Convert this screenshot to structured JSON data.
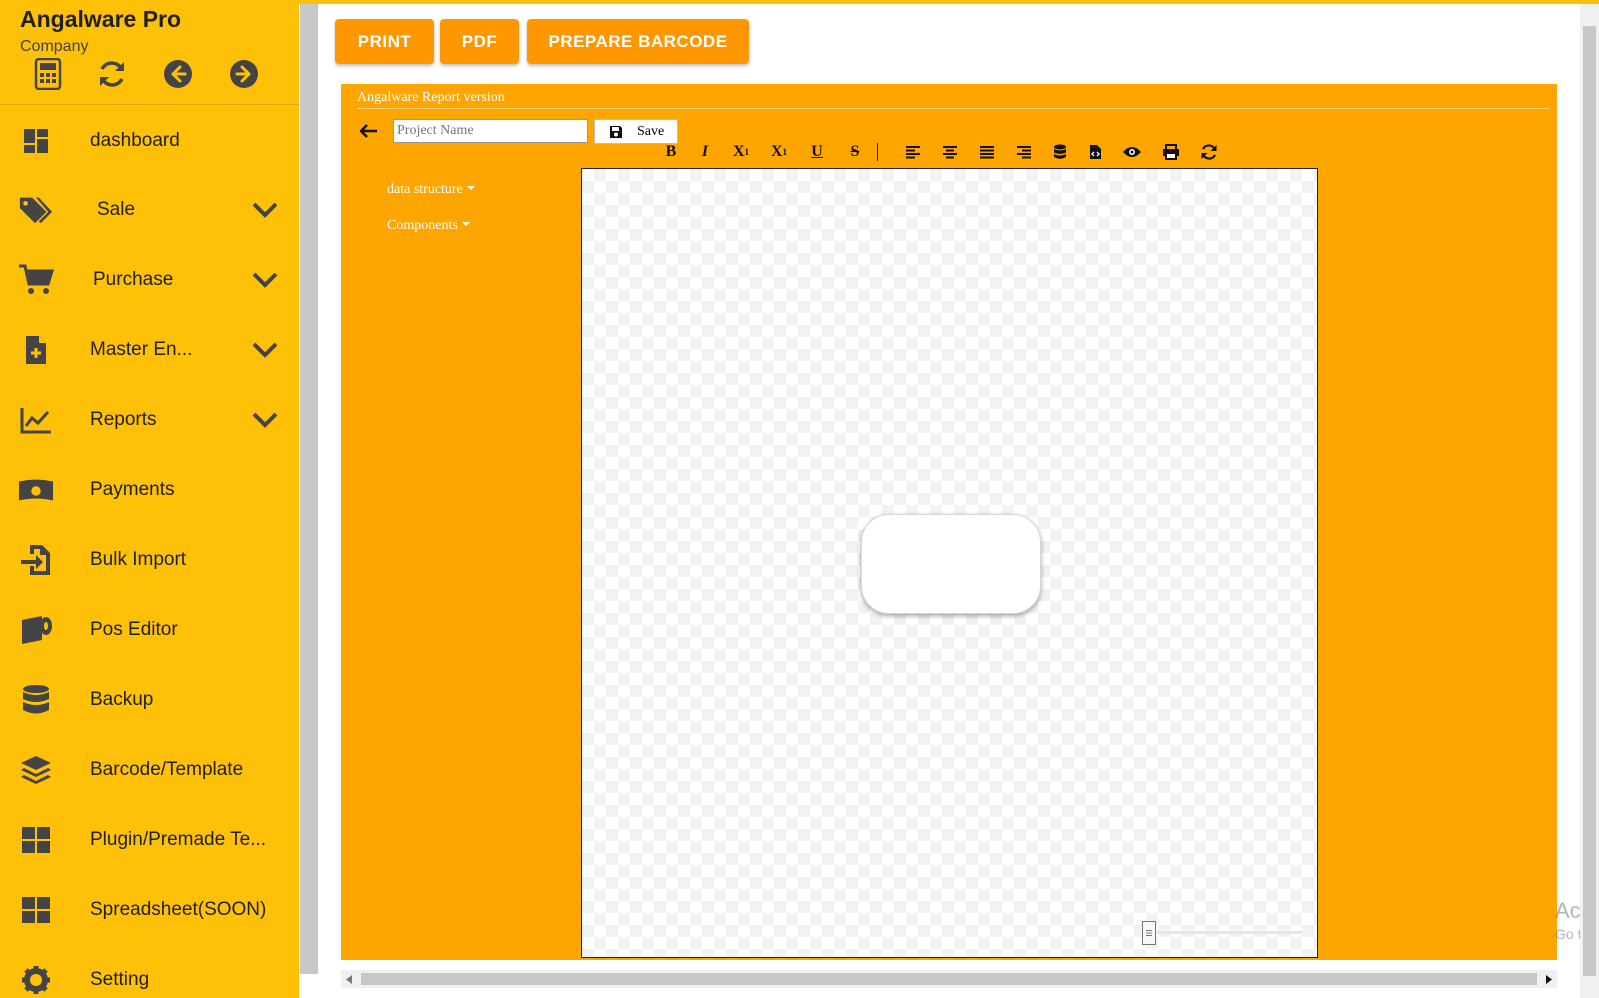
{
  "app": {
    "title": "Angalware Pro",
    "subtitle": "Company"
  },
  "quick_icons": [
    "calculator-icon",
    "refresh-icon",
    "arrow-left-circle-icon",
    "arrow-right-circle-icon"
  ],
  "sidebar": {
    "items": [
      {
        "label": "dashboard",
        "icon": "dashboard-icon",
        "expandable": false
      },
      {
        "label": "Sale",
        "icon": "tags-icon",
        "expandable": true
      },
      {
        "label": "Purchase",
        "icon": "cart-icon",
        "expandable": true
      },
      {
        "label": "Master En...",
        "icon": "file-plus-icon",
        "expandable": true
      },
      {
        "label": "Reports",
        "icon": "chart-line-icon",
        "expandable": true
      },
      {
        "label": "Payments",
        "icon": "money-icon",
        "expandable": false
      },
      {
        "label": "Bulk Import",
        "icon": "import-icon",
        "expandable": false
      },
      {
        "label": "Pos Editor",
        "icon": "receipt-roll-icon",
        "expandable": false
      },
      {
        "label": "Backup",
        "icon": "database-icon",
        "expandable": false
      },
      {
        "label": "Barcode/Template",
        "icon": "layers-icon",
        "expandable": false
      },
      {
        "label": "Plugin/Premade Te...",
        "icon": "grid-icon",
        "expandable": false
      },
      {
        "label": "Spreadsheet(SOON)",
        "icon": "grid-icon",
        "expandable": false
      },
      {
        "label": "Setting",
        "icon": "gear-icon",
        "expandable": false
      }
    ]
  },
  "top_buttons": {
    "print": "PRINT",
    "pdf": "PDF",
    "barcode": "PREPARE BARCODE"
  },
  "report": {
    "title": "Angalware Report version",
    "project_placeholder": "Project Name",
    "save_label": "Save",
    "menus": {
      "data_structure": "data structure",
      "components": "Components"
    },
    "toolbar": [
      "bold-icon",
      "italic-icon",
      "superscript-icon",
      "subscript-icon",
      "underline-icon",
      "strikethrough-icon",
      "align-left-icon",
      "align-center-icon",
      "align-justify-icon",
      "align-right-icon",
      "database-icon",
      "file-code-icon",
      "eye-icon",
      "print-icon",
      "refresh-icon"
    ]
  },
  "colors": {
    "sidebar": "#ffc107",
    "accent": "#ff9800",
    "panel": "#ffa500"
  },
  "watermark": {
    "line1": "Acti",
    "line2": "Go to"
  }
}
